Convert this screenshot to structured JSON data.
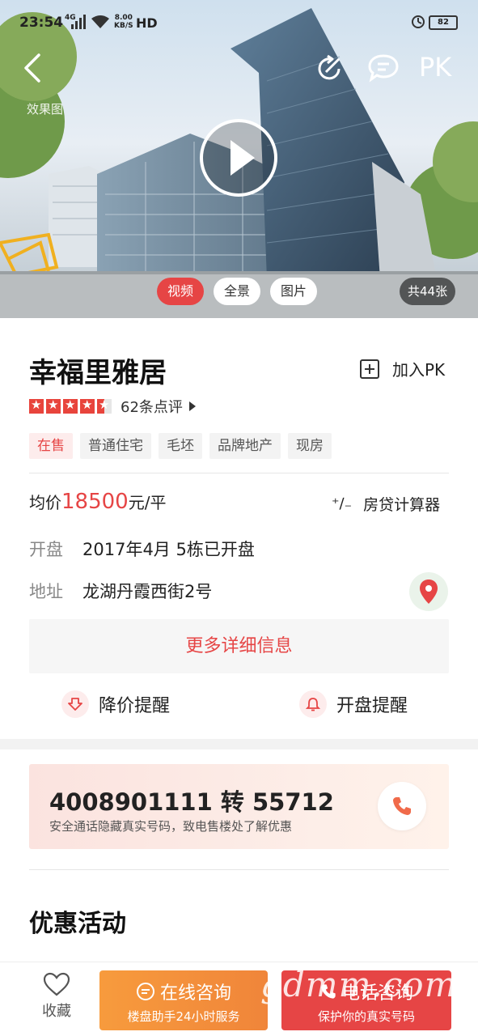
{
  "status_bar": {
    "time": "23:54",
    "network": "4G",
    "speed_value": "8.00",
    "speed_unit": "KB/S",
    "hd": "HD",
    "battery": "82"
  },
  "header": {
    "pk_label": "PK",
    "watermark": "效果图"
  },
  "media": {
    "tabs": [
      "视频",
      "全景",
      "图片"
    ],
    "active_tab": "视频",
    "photo_count": "共44张"
  },
  "property": {
    "name": "幸福里雅居",
    "add_pk_label": "加入PK",
    "rating_stars": 4.5,
    "reviews": "62条点评",
    "tags": [
      "在售",
      "普通住宅",
      "毛坯",
      "品牌地产",
      "现房"
    ],
    "price_prefix": "均价",
    "price_value": "18500",
    "price_unit": "元/平",
    "calculator_label": "房贷计算器",
    "opening_label": "开盘",
    "opening_value": "2017年4月 5栋已开盘",
    "address_label": "地址",
    "address_value": "龙湖丹霞西街2号",
    "more_info_label": "更多详细信息",
    "price_alert_label": "降价提醒",
    "opening_alert_label": "开盘提醒"
  },
  "phone": {
    "number": "4008901111 转 55712",
    "hint": "安全通话隐藏真实号码，致电售楼处了解优惠"
  },
  "promotions": {
    "title": "优惠活动"
  },
  "bottom_bar": {
    "favorite_label": "收藏",
    "online_label": "在线咨询",
    "online_sub": "楼盘助手24小时服务",
    "call_label": "电话咨询",
    "call_sub": "保护你的真实号码",
    "watermark_logo": "gdmm.com"
  },
  "colors": {
    "accent_red": "#e64545",
    "accent_orange": "#f0853a"
  }
}
